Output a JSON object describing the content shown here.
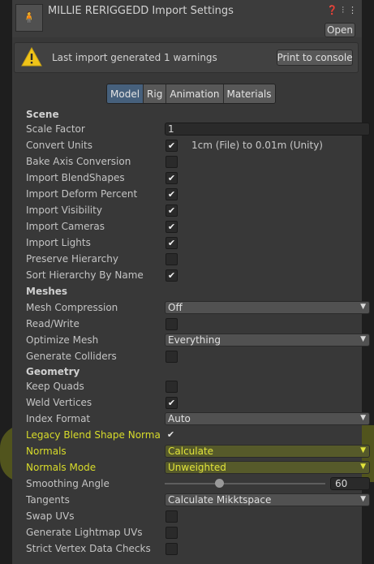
{
  "header": {
    "title": "MILLIE RERIGGEDD Import Settings",
    "open_label": "Open"
  },
  "warning": {
    "text": "Last import generated 1 warnings",
    "button": "Print to console"
  },
  "tabs": [
    "Model",
    "Rig",
    "Animation",
    "Materials"
  ],
  "scene": {
    "header": "Scene",
    "scale_factor": {
      "label": "Scale Factor",
      "value": "1"
    },
    "convert_units": {
      "label": "Convert Units",
      "note": "1cm (File) to 0.01m (Unity)"
    },
    "bake_axis": "Bake Axis Conversion",
    "blendshapes": "Import BlendShapes",
    "deform_percent": "Import Deform Percent",
    "visibility": "Import Visibility",
    "cameras": "Import Cameras",
    "lights": "Import Lights",
    "preserve_hierarchy": "Preserve Hierarchy",
    "sort_hierarchy": "Sort Hierarchy By Name"
  },
  "meshes": {
    "header": "Meshes",
    "compression": {
      "label": "Mesh Compression",
      "value": "Off"
    },
    "read_write": "Read/Write",
    "optimize": {
      "label": "Optimize Mesh",
      "value": "Everything"
    },
    "colliders": "Generate Colliders"
  },
  "geometry": {
    "header": "Geometry",
    "keep_quads": "Keep Quads",
    "weld_vertices": "Weld Vertices",
    "index_format": {
      "label": "Index Format",
      "value": "Auto"
    },
    "legacy_blend": "Legacy Blend Shape Norma",
    "normals": {
      "label": "Normals",
      "value": "Calculate"
    },
    "normals_mode": {
      "label": "Normals Mode",
      "value": "Unweighted"
    },
    "smoothing": {
      "label": "Smoothing Angle",
      "value": "60",
      "fraction": 0.33
    },
    "tangents": {
      "label": "Tangents",
      "value": "Calculate Mikktspace"
    },
    "swap_uvs": "Swap UVs",
    "lightmap_uvs": "Generate Lightmap UVs",
    "strict_vertex": "Strict Vertex Data Checks"
  },
  "icons": {
    "asset": "model-asset-icon",
    "help": "help-icon",
    "presets": "presets-icon",
    "menu": "kebab-menu-icon",
    "warning": "warning-triangle-icon",
    "check": "checkmark-icon",
    "dropdown": "chevron-down-icon"
  },
  "colors": {
    "highlight": "#d7e11e",
    "tab_active": "#46607c",
    "warning": "#f0c419"
  }
}
